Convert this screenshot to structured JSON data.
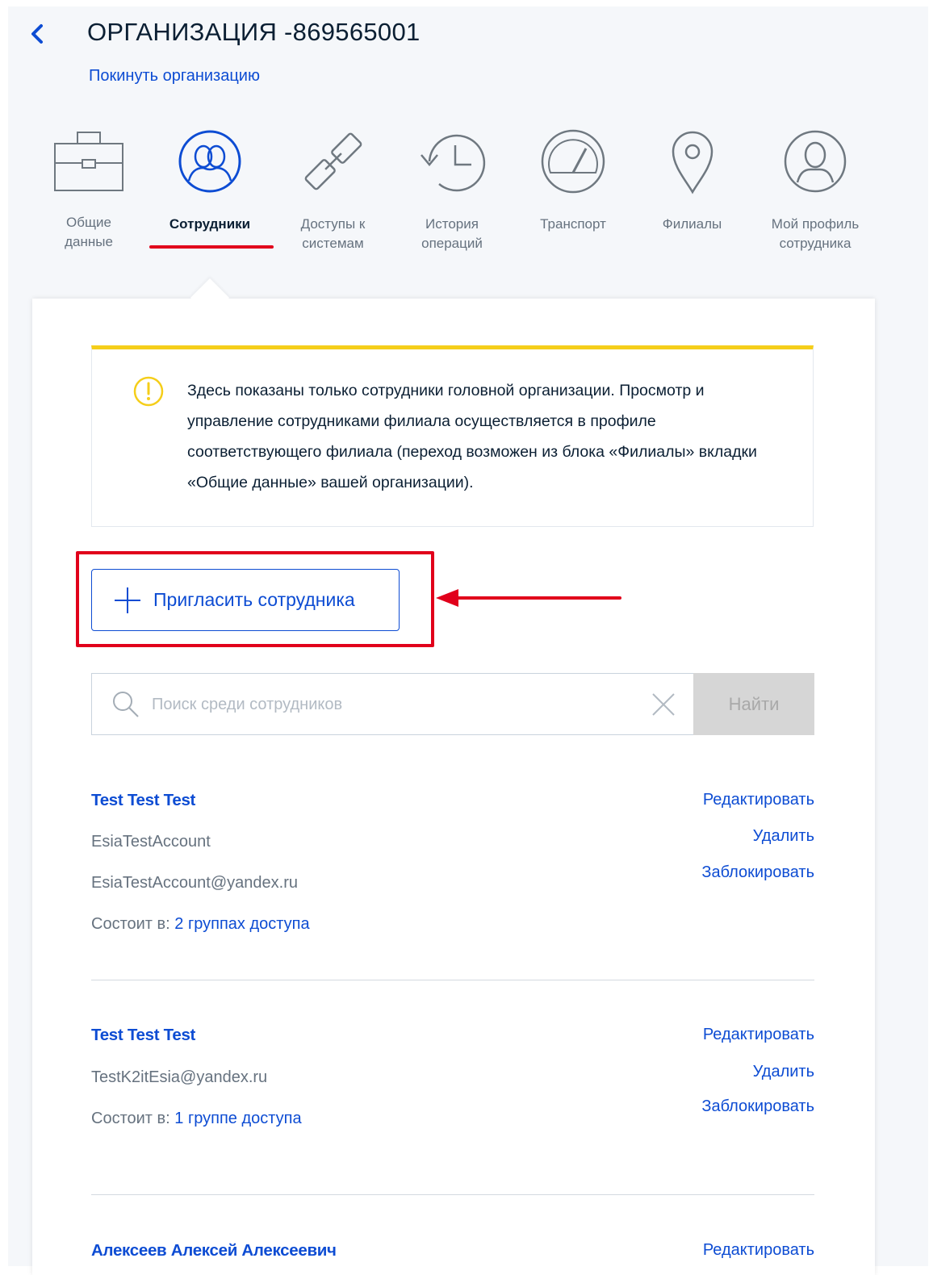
{
  "header": {
    "title": "ОРГАНИЗАЦИЯ -869565001",
    "leave_link": "Покинуть организацию"
  },
  "tabs": [
    {
      "label": "Общие\nданные",
      "icon": "briefcase-icon",
      "active": false
    },
    {
      "label": "Сотрудники",
      "icon": "people-icon",
      "active": true
    },
    {
      "label": "Доступы к\nсистемам",
      "icon": "chain-link-icon",
      "active": false
    },
    {
      "label": "История\nопераций",
      "icon": "history-clock-icon",
      "active": false
    },
    {
      "label": "Транспорт",
      "icon": "speedometer-icon",
      "active": false
    },
    {
      "label": "Филиалы",
      "icon": "map-pin-icon",
      "active": false
    },
    {
      "label": "Мой профиль\nсотрудника",
      "icon": "user-profile-icon",
      "active": false
    }
  ],
  "notice": {
    "text": "Здесь показаны только сотрудники головной организации. Просмотр и управление сотрудниками филиала осуществляется в профиле соответствующего филиала (переход возможен из блока «Филиалы» вкладки «Общие данные» вашей организации)."
  },
  "invite_button": {
    "label": "Пригласить сотрудника"
  },
  "search": {
    "placeholder": "Поиск среди сотрудников",
    "value": "",
    "button": "Найти"
  },
  "actions": {
    "edit": "Редактировать",
    "delete": "Удалить",
    "block": "Заблокировать"
  },
  "employees": [
    {
      "name": "Test Test Test",
      "login": "EsiaTestAccount",
      "email": "EsiaTestAccount@yandex.ru",
      "member_prefix": "Состоит в:",
      "groups": "2 группах доступа"
    },
    {
      "name": "Test Test Test",
      "email": "TestK2itEsia@yandex.ru",
      "member_prefix": "Состоит в:",
      "groups": "1 группе доступа"
    },
    {
      "name": "Алексеев Алексей Алексеевич"
    }
  ],
  "colors": {
    "link": "#0d4cd3",
    "accent_red": "#e1001b",
    "warning_yellow": "#f5ce1a",
    "text": "#0b1f33",
    "muted": "#66727f"
  }
}
